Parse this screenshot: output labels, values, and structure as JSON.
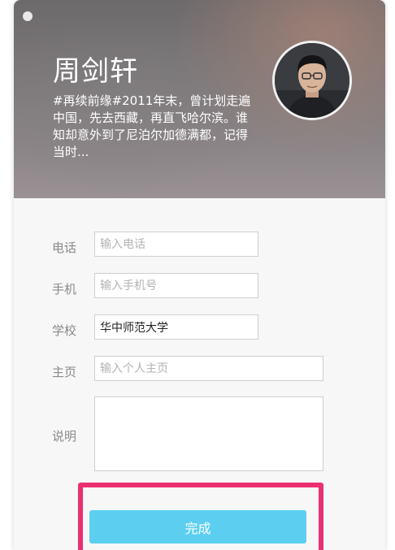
{
  "profile": {
    "name": "周剑轩",
    "bio": "#再续前缘#2011年末，曾计划走遍中国，先去西藏，再直飞哈尔滨。谁知却意外到了尼泊尔加德满都，记得当时..."
  },
  "form": {
    "phone": {
      "label": "电话",
      "placeholder": "输入电话",
      "value": ""
    },
    "mobile": {
      "label": "手机",
      "placeholder": "输入手机号",
      "value": ""
    },
    "school": {
      "label": "学校",
      "placeholder": "",
      "value": "华中师范大学"
    },
    "homepage": {
      "label": "主页",
      "placeholder": "输入个人主页",
      "value": ""
    },
    "description": {
      "label": "说明",
      "placeholder": "",
      "value": ""
    }
  },
  "actions": {
    "done_label": "完成"
  },
  "colors": {
    "done_button": "#5ccff0",
    "highlight_border": "#ec2f73",
    "label_text": "#8a8a8a",
    "placeholder_text": "#b3b3b3"
  }
}
